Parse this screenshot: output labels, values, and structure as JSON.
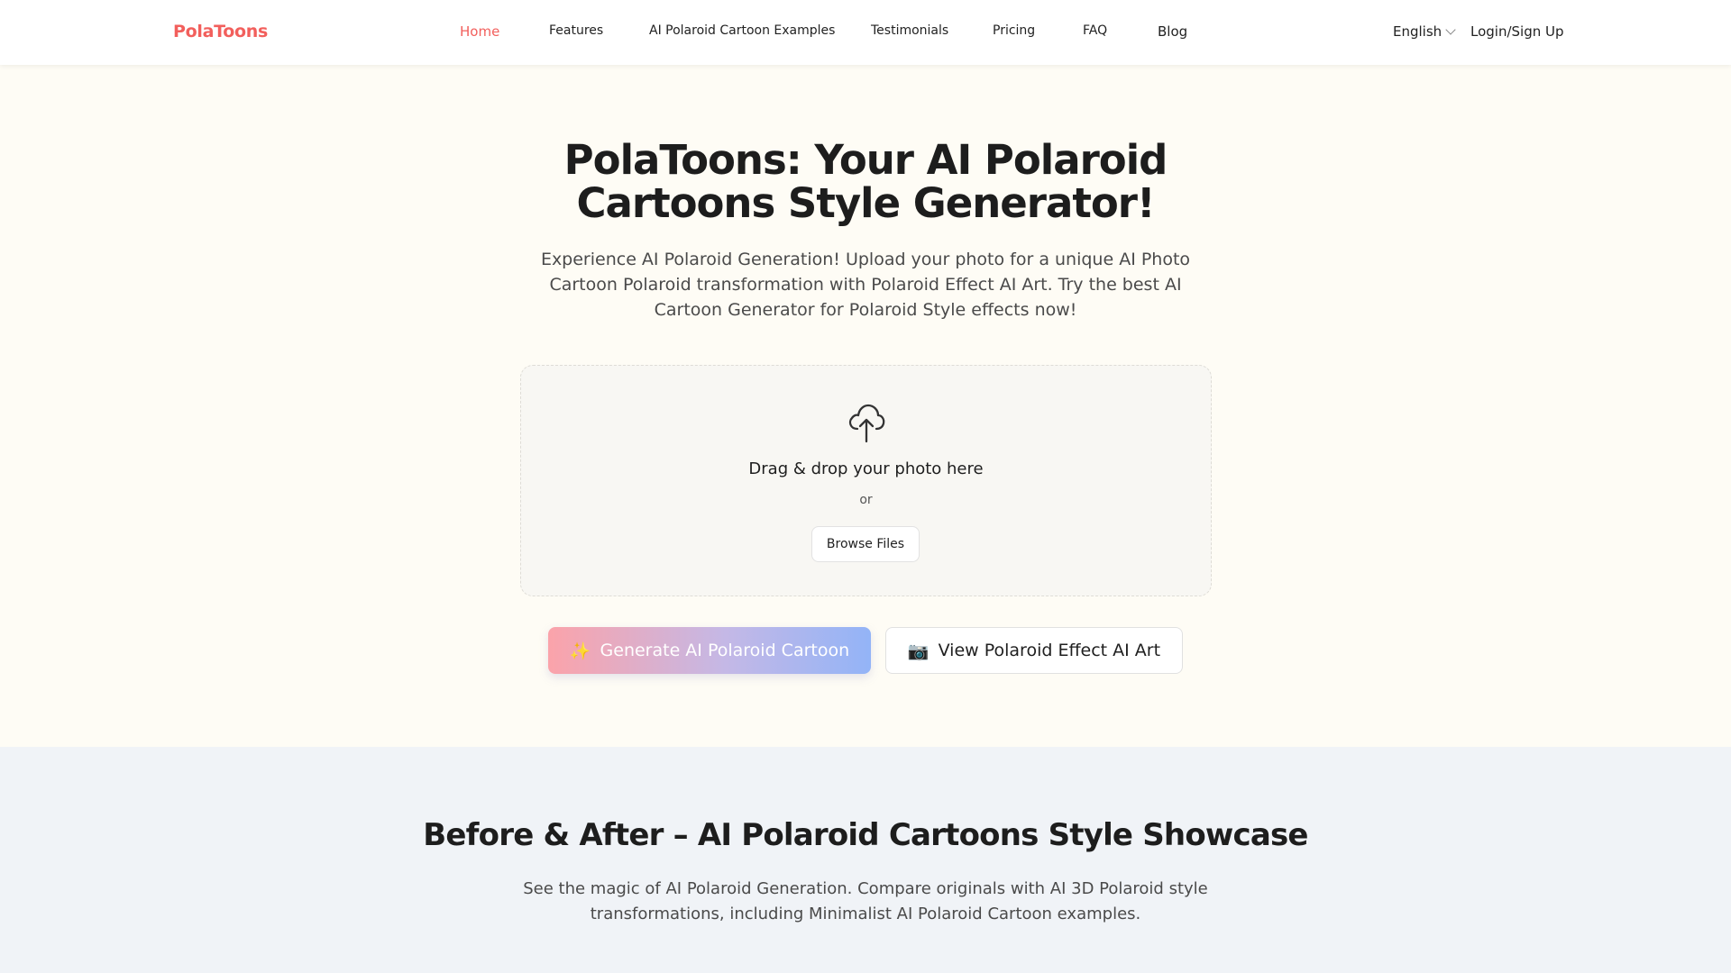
{
  "brand": {
    "name": "PolaToons",
    "accent": "#f25f5c"
  },
  "nav": {
    "items": [
      {
        "label": "Home",
        "active": true
      },
      {
        "label": "Features"
      },
      {
        "label": "AI Polaroid Cartoon Examples"
      },
      {
        "label": "Testimonials"
      },
      {
        "label": "Pricing"
      },
      {
        "label": "FAQ"
      },
      {
        "label": "Blog"
      }
    ],
    "language": "English",
    "login": "Login/Sign Up"
  },
  "hero": {
    "title_line1": "PolaToons: Your AI Polaroid",
    "title_line2": "Cartoons Style Generator!",
    "subtitle": "Experience AI Polaroid Generation! Upload your photo for a unique AI Photo Cartoon Polaroid transformation with Polaroid Effect AI Art. Try the best AI Cartoon Generator for Polaroid Style effects now!"
  },
  "upload": {
    "icon": "cloud-upload-icon",
    "title": "Drag & drop your photo here",
    "or": "or",
    "browse": "Browse Files"
  },
  "actions": {
    "generate": {
      "icon": "sparkles-icon",
      "glyph": "✨",
      "label": "Generate AI Polaroid Cartoon"
    },
    "view": {
      "icon": "camera-icon",
      "glyph": "📷",
      "label": "View Polaroid Effect AI Art"
    }
  },
  "showcase": {
    "title": "Before & After – AI Polaroid Cartoons Style Showcase",
    "subtitle": "See the magic of AI Polaroid Generation. Compare originals with AI 3D Polaroid style transformations, including Minimalist AI Polaroid Cartoon examples."
  }
}
